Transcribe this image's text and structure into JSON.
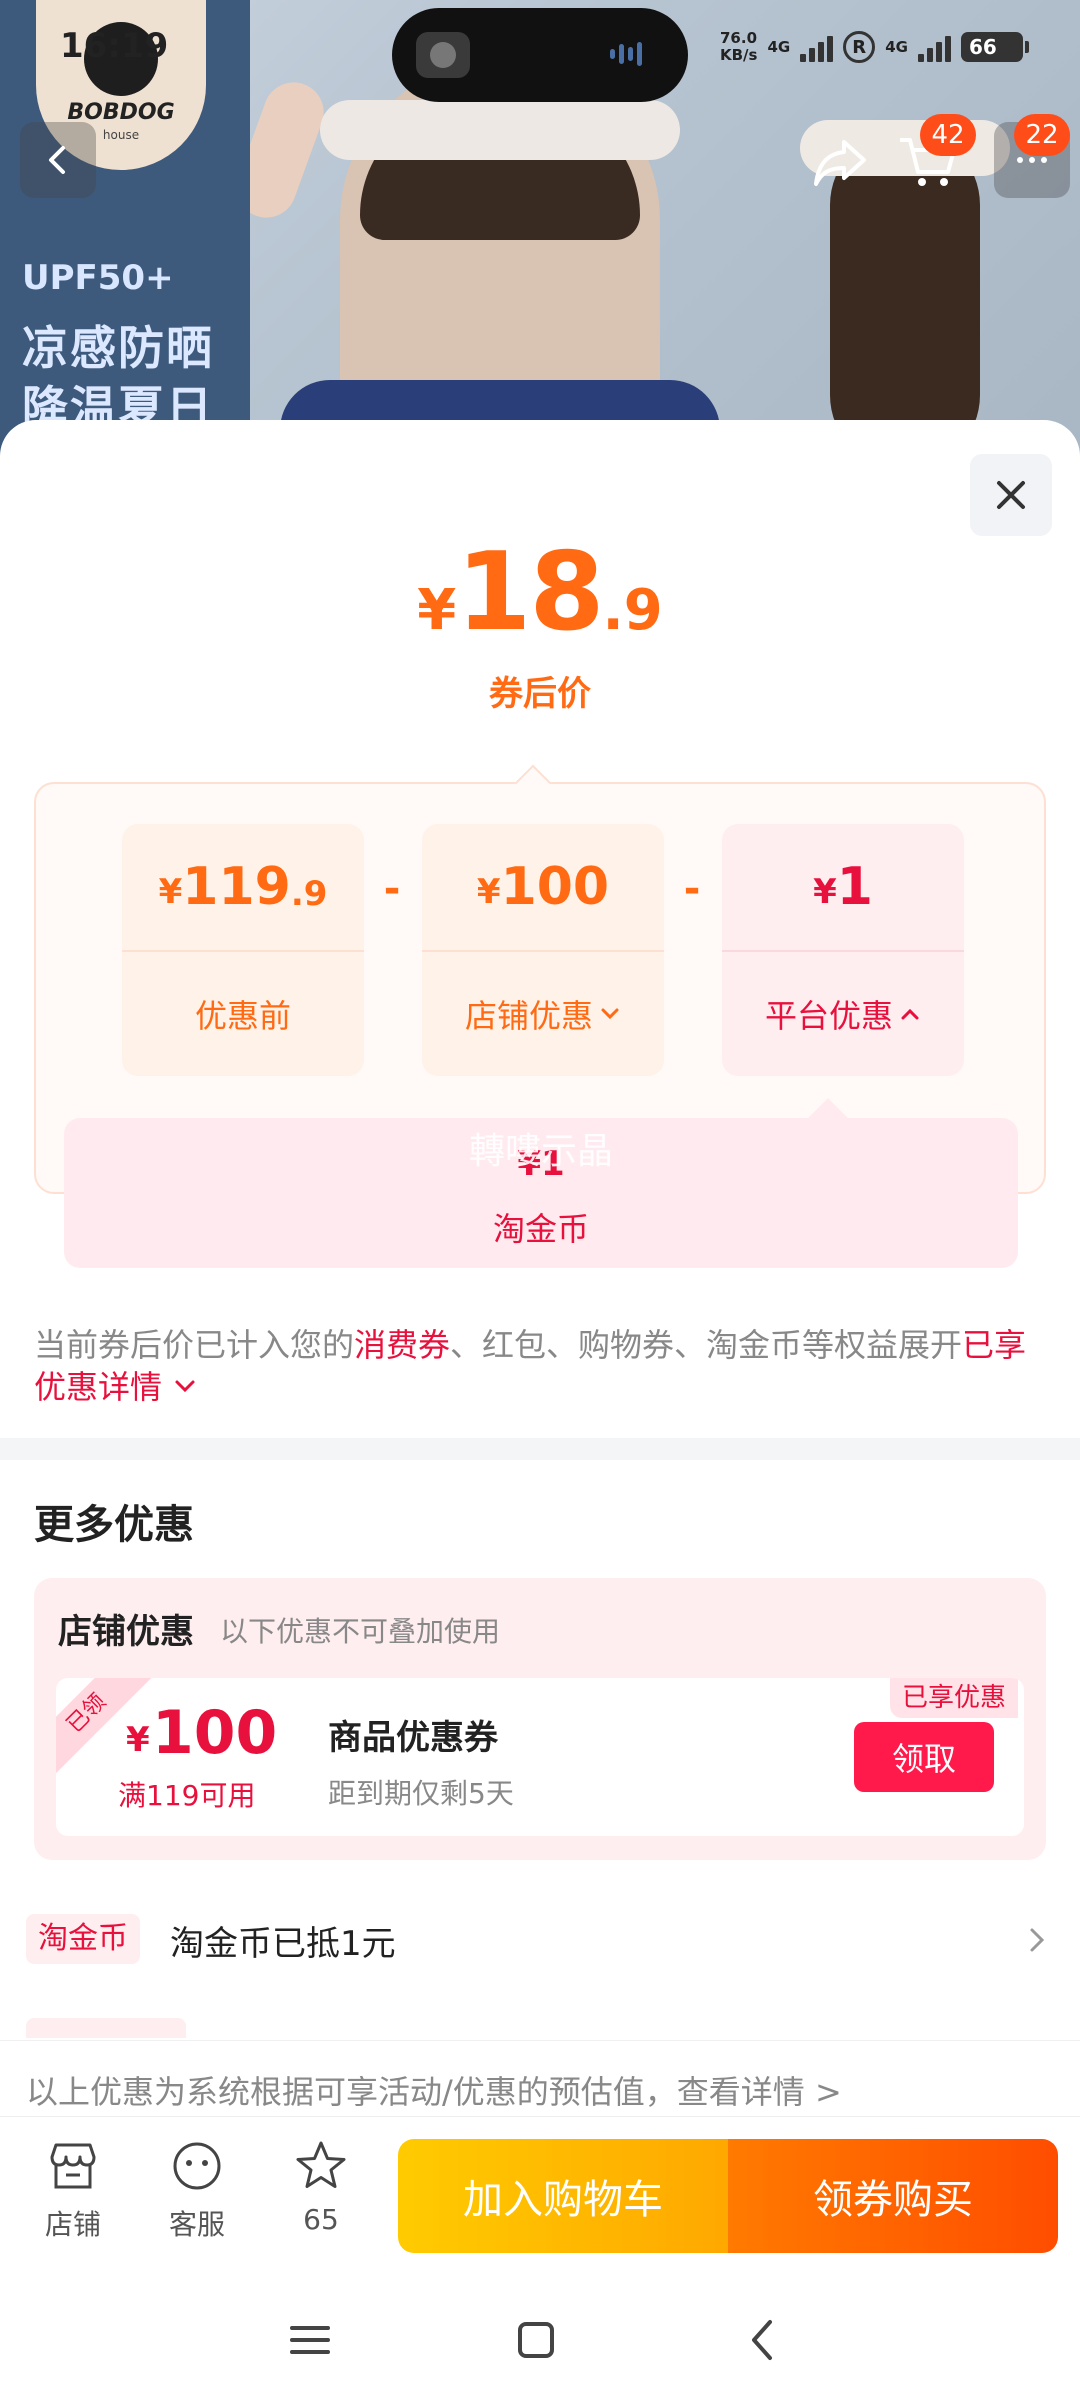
{
  "status_bar": {
    "time": "16:19",
    "speed_value": "76.0",
    "speed_unit": "KB/s",
    "network_1": "4G",
    "network_2": "4G",
    "r_label": "R",
    "battery": "66"
  },
  "hero": {
    "brand": "BOBDOG",
    "brand_sub": "house",
    "upf": "UPF50+",
    "tagline_1": "凉感防晒",
    "tagline_2": "降温夏日"
  },
  "header": {
    "cart_count": "42",
    "more_count": "22"
  },
  "price": {
    "currency": "¥",
    "integer": "18",
    "decimal": ".9",
    "label": "券后价"
  },
  "breakdown": {
    "original": {
      "currency": "¥",
      "integer": "119",
      "decimal": ".9",
      "label": "优惠前"
    },
    "minus": "-",
    "store": {
      "currency": "¥",
      "integer": "100",
      "label": "店铺优惠"
    },
    "platform": {
      "currency": "¥",
      "integer": "1",
      "label": "平台优惠"
    },
    "platform_detail": {
      "value": "¥1",
      "name": "淘金币",
      "watermark": "轉嘍示晶"
    }
  },
  "note": {
    "p1": "当前券后价已计入您的",
    "hl1": "消费券",
    "p2": "、红包、购物券、淘金币等权益展开",
    "hl2": "已享优惠详情"
  },
  "more": {
    "title": "更多优惠",
    "store_section": {
      "title": "店铺优惠",
      "subtitle": "以下优惠不可叠加使用"
    },
    "coupon": {
      "received_tag": "已领",
      "currency": "¥",
      "value": "100",
      "condition": "满119可用",
      "name": "商品优惠券",
      "expiry": "距到期仅剩5天",
      "enjoyed_tag": "已享优惠",
      "claim_label": "领取"
    },
    "coin_row": {
      "chip": "淘金币",
      "text": "淘金币已抵1元"
    }
  },
  "disclaimer": "以上优惠为系统根据可享活动/优惠的预估值，查看详情 >",
  "bottom_bar": {
    "store": "店铺",
    "service": "客服",
    "favorites": "65",
    "add_to_cart": "加入购物车",
    "buy": "领券购买"
  },
  "colors": {
    "accent_orange": "#ff6a13",
    "accent_red": "#e8103c"
  }
}
